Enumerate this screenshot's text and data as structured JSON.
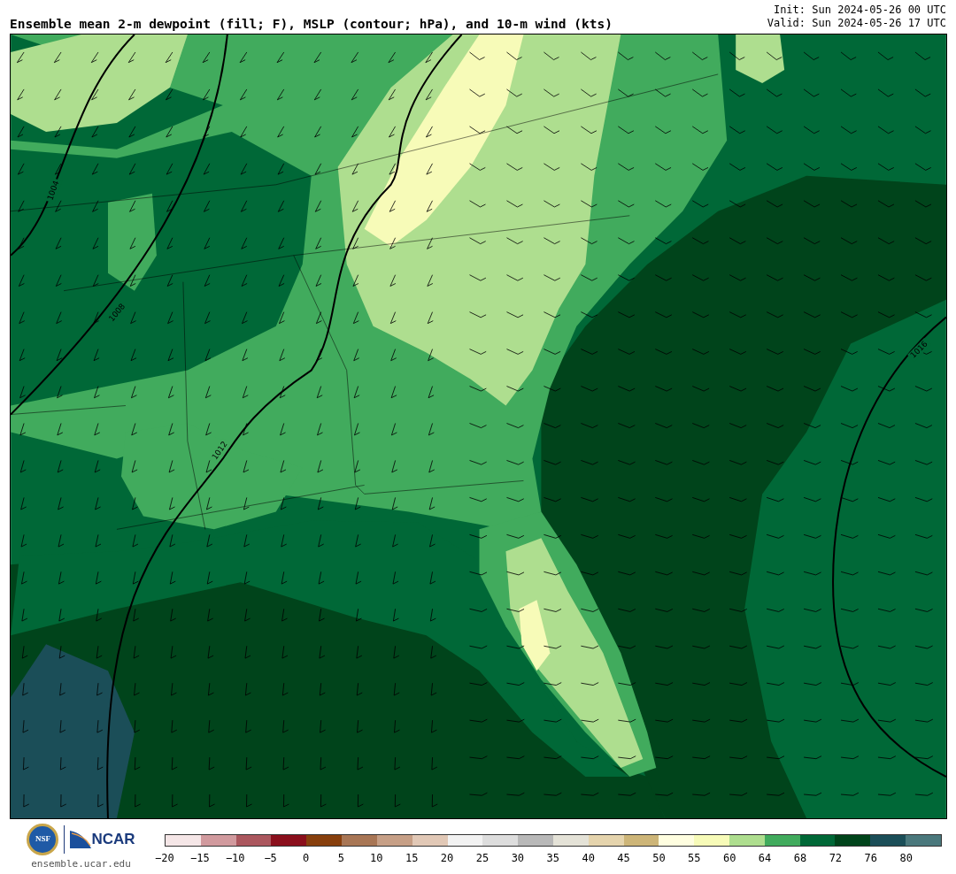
{
  "title": "Ensemble mean 2-m dewpoint (fill; F), MSLP (contour; hPa), and 10-m wind (kts)",
  "init": "Init: Sun 2024-05-26 00 UTC",
  "valid": "Valid: Sun 2024-05-26 17 UTC",
  "contour_labels": [
    "1004",
    "1008",
    "1012",
    "1016"
  ],
  "logo": {
    "nsf": "NSF",
    "ncar": "NCAR",
    "site": "ensemble.ucar.edu"
  },
  "colorbar": {
    "segments": [
      {
        "color": "#f5e6e7"
      },
      {
        "color": "#d19a9e"
      },
      {
        "color": "#ab575e"
      },
      {
        "color": "#8a0f1c"
      },
      {
        "color": "#873f0d"
      },
      {
        "color": "#a87655"
      },
      {
        "color": "#c69f86"
      },
      {
        "color": "#e1c8b6"
      },
      {
        "color": "#f2f2f2"
      },
      {
        "color": "#dddddd"
      },
      {
        "color": "#b8b8b8"
      },
      {
        "color": "#e4e2d7"
      },
      {
        "color": "#e5d4ad"
      },
      {
        "color": "#cdb578"
      },
      {
        "color": "#fffee0"
      },
      {
        "color": "#f7fbb8"
      },
      {
        "color": "#aede8f"
      },
      {
        "color": "#41ab5d"
      },
      {
        "color": "#006837"
      },
      {
        "color": "#00441b"
      },
      {
        "color": "#1b4e58"
      },
      {
        "color": "#4a787c"
      }
    ],
    "ticks": [
      "−20",
      "−15",
      "−10",
      "−5",
      "0",
      "5",
      "10",
      "15",
      "20",
      "25",
      "30",
      "35",
      "40",
      "45",
      "50",
      "55",
      "60",
      "64",
      "68",
      "72",
      "76",
      "80"
    ]
  }
}
